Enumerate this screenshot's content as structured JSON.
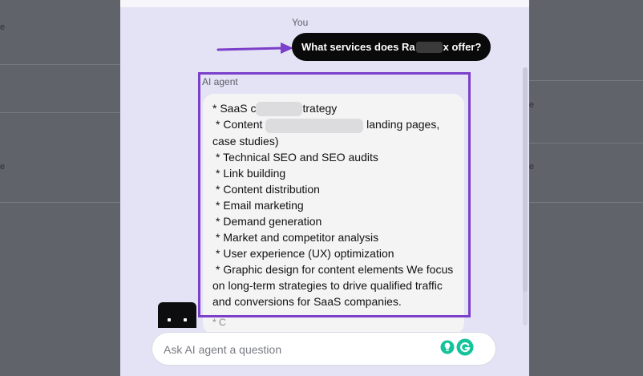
{
  "background": {
    "left_fragments": [
      "e",
      "e"
    ],
    "right_fragments": [
      "e",
      "e"
    ]
  },
  "chat": {
    "user_label": "You",
    "user_message_prefix": "What services does Ra",
    "user_message_suffix": "x offer?",
    "agent_label": "AI agent",
    "agent_lines": {
      "l1_prefix": "* SaaS c",
      "l1_suffix": "trategy",
      "l2_prefix": "* Content",
      "l2_suffix": "landing pages,",
      "l3": "case studies)",
      "l4": "* Technical SEO and SEO audits",
      "l5": "* Link building",
      "l6": "* Content distribution",
      "l7": "* Email marketing",
      "l8": "* Demand generation",
      "l9": "* Market and competitor analysis",
      "l10": "* User experience (UX) optimization",
      "l11": "* Graphic design for content elements We focus",
      "l12": "on long-term strategies to drive qualified traffic",
      "l13": "and conversions for SaaS companies.",
      "l14": "* C"
    }
  },
  "input": {
    "placeholder": "Ask AI agent a question",
    "value": ""
  },
  "icons": {
    "annotation_arrow": "arrow-right-icon",
    "bulb": "lightbulb-icon",
    "grammar": "grammarly-icon"
  },
  "colors": {
    "panel_bg": "#e4e3f6",
    "accent_purple": "#7b3fc9",
    "user_bubble": "#0a0a0a",
    "agent_bubble": "#f4f4f5",
    "grammarly_green": "#15c39a"
  }
}
